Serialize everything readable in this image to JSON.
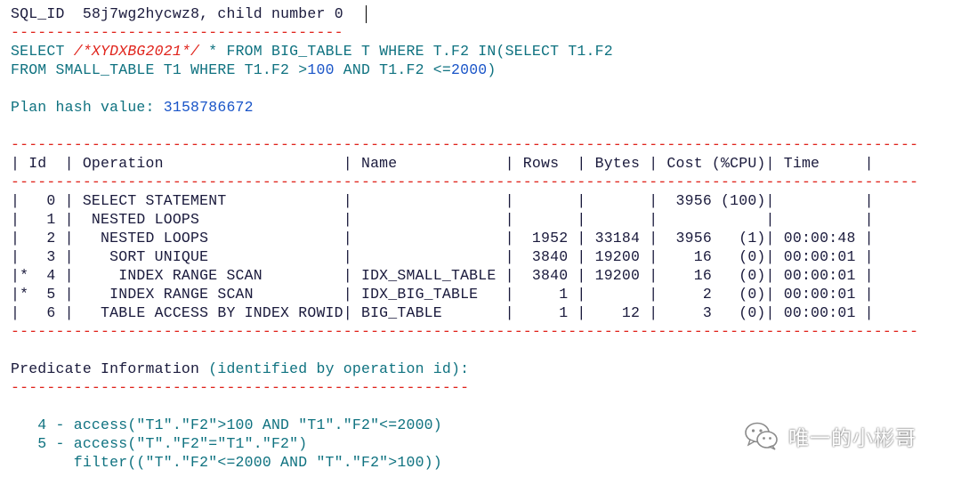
{
  "header": {
    "sql_id_label": "SQL_ID",
    "sql_id_value": "58j7wg2hycwz8",
    "child_label": ", child number",
    "child_value": "0"
  },
  "sep1": "-------------------------------------",
  "sql": {
    "line1_a": "SELECT ",
    "line1_comment": "/*XYDXBG2021*/",
    "line1_b": " * FROM BIG_TABLE T WHERE T.F2 IN(SELECT T1.F2",
    "line2_a": "FROM SMALL_TABLE T1 WHERE T1.F2 >",
    "line2_n1": "100",
    "line2_b": " AND T1.F2 <=",
    "line2_n2": "2000",
    "line2_c": ")"
  },
  "plan_hash": {
    "label": "Plan hash value: ",
    "value": "3158786672"
  },
  "plan_sep": "-----------------------------------------------------------------------------------------------------",
  "plan_header": "| Id  | Operation                    | Name            | Rows  | Bytes | Cost (%CPU)| Time     |",
  "plan_rows": [
    "|   0 | SELECT STATEMENT             |                 |       |       |  3956 (100)|          |",
    "|   1 |  NESTED LOOPS                |                 |       |       |            |          |",
    "|   2 |   NESTED LOOPS               |                 |  1952 | 33184 |  3956   (1)| 00:00:48 |",
    "|   3 |    SORT UNIQUE               |                 |  3840 | 19200 |    16   (0)| 00:00:01 |",
    "|*  4 |     INDEX RANGE SCAN         | IDX_SMALL_TABLE |  3840 | 19200 |    16   (0)| 00:00:01 |",
    "|*  5 |    INDEX RANGE SCAN          | IDX_BIG_TABLE   |     1 |       |     2   (0)| 00:00:01 |",
    "|   6 |   TABLE ACCESS BY INDEX ROWID| BIG_TABLE       |     1 |    12 |     3   (0)| 00:00:01 |"
  ],
  "predicate": {
    "title_a": "Predicate Information ",
    "title_b": "(identified by operation id):",
    "sep": "---------------------------------------------------",
    "p4": "   4 - access(\"T1\".\"F2\">100 AND \"T1\".\"F2\"<=2000)",
    "p5": "   5 - access(\"T\".\"F2\"=\"T1\".\"F2\")",
    "p5b": "       filter((\"T\".\"F2\"<=2000 AND \"T\".\"F2\">100))"
  },
  "watermark": {
    "icon": "wechat-icon",
    "text": "唯一的小彬哥"
  }
}
